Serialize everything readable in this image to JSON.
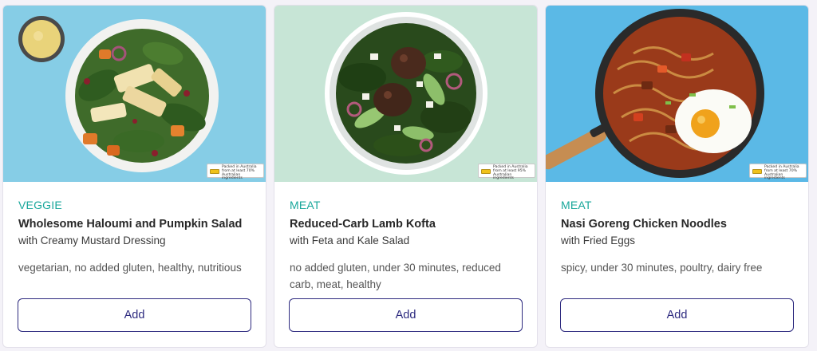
{
  "colors": {
    "accent_category": "#19a79b",
    "button_border": "#2d2a7f",
    "card_bg": "#ffffff"
  },
  "cards": [
    {
      "image": "salad-bowl-image",
      "badge_text": "Packed in Australia from at least 70% Australian ingredients",
      "category": "VEGGIE",
      "title": "Wholesome Haloumi and Pumpkin Salad",
      "subtitle": "with Creamy Mustard Dressing",
      "tags": "vegetarian, no added gluten, healthy, nutritious",
      "button": "Add"
    },
    {
      "image": "kofta-plate-image",
      "badge_text": "Packed in Australia from at least 95% Australian ingredients",
      "category": "MEAT",
      "title": "Reduced-Carb Lamb Kofta",
      "subtitle": "with Feta and Kale Salad",
      "tags": "no added gluten, under 30 minutes, reduced carb, meat, healthy",
      "button": "Add"
    },
    {
      "image": "noodle-pan-image",
      "badge_text": "Packed in Australia from at least 70% Australian ingredients",
      "category": "MEAT",
      "title": "Nasi Goreng Chicken Noodles",
      "subtitle": "with Fried Eggs",
      "tags": "spicy, under 30 minutes, poultry, dairy free",
      "button": "Add"
    }
  ]
}
